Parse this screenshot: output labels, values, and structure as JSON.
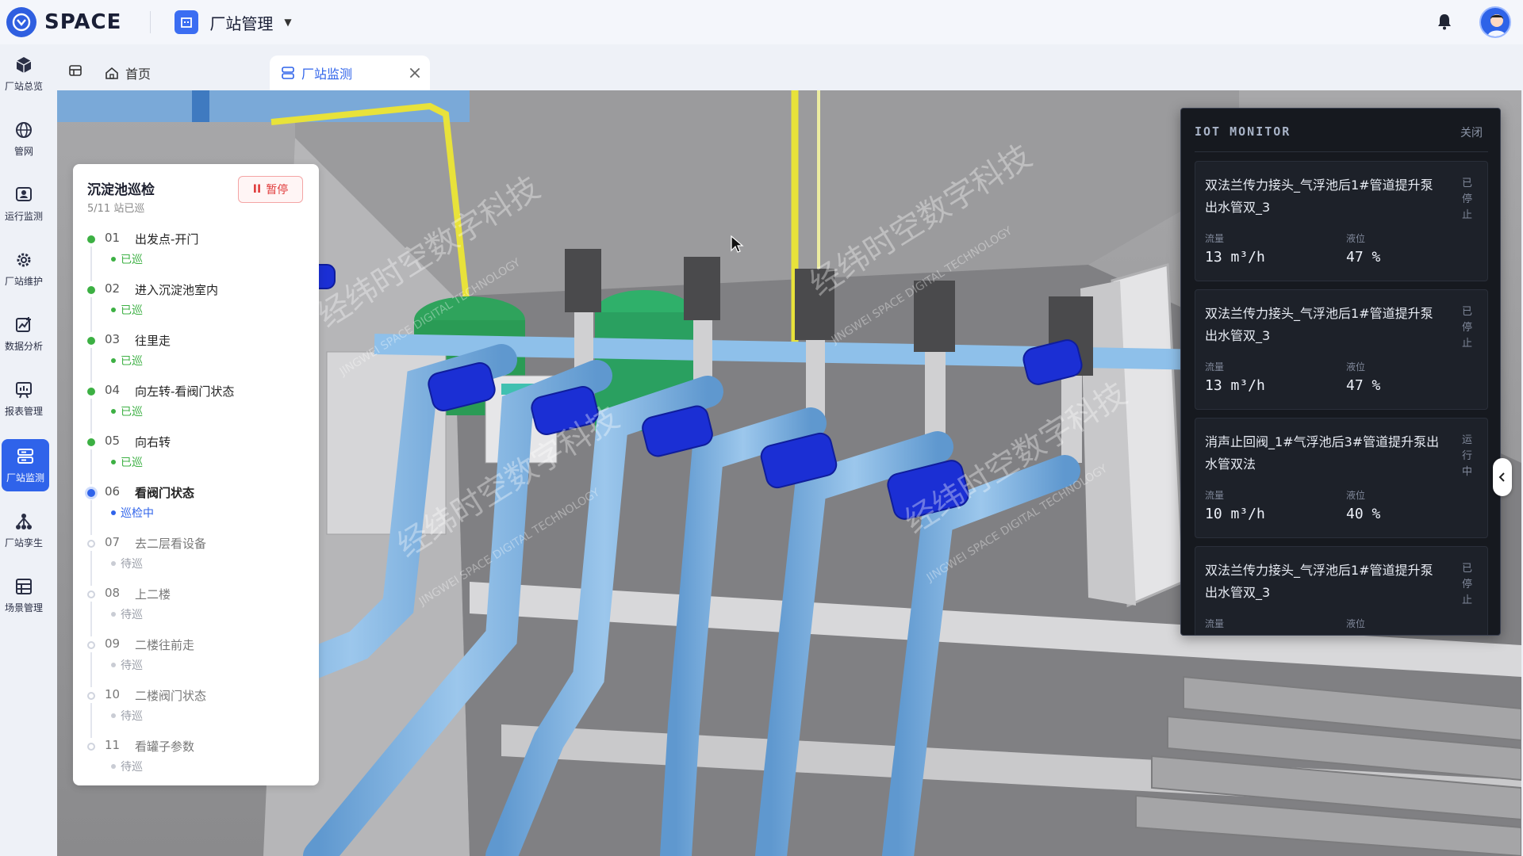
{
  "app": {
    "logo_text": "SPACE",
    "module_title": "厂站管理"
  },
  "sidebar": {
    "items": [
      {
        "label": "厂站总览",
        "icon": "cube-icon"
      },
      {
        "label": "管网",
        "icon": "globe-icon"
      },
      {
        "label": "运行监测",
        "icon": "monitor-icon"
      },
      {
        "label": "厂站维护",
        "icon": "gear-icon"
      },
      {
        "label": "数据分析",
        "icon": "chart-icon"
      },
      {
        "label": "报表管理",
        "icon": "report-icon"
      },
      {
        "label": "厂站监测",
        "icon": "server-icon",
        "active": true
      },
      {
        "label": "厂站孪生",
        "icon": "network-icon"
      },
      {
        "label": "场景管理",
        "icon": "scene-icon"
      }
    ]
  },
  "tabs": {
    "home": "首页",
    "active": "厂站监测"
  },
  "patrol": {
    "title": "沉淀池巡检",
    "progress": "5/11 站已巡",
    "pause_label": "暂停",
    "steps": [
      {
        "no": "01",
        "name": "出发点-开门",
        "status": "已巡"
      },
      {
        "no": "02",
        "name": "进入沉淀池室内",
        "status": "已巡"
      },
      {
        "no": "03",
        "name": "往里走",
        "status": "已巡"
      },
      {
        "no": "04",
        "name": "向左转-看阀门状态",
        "status": "已巡"
      },
      {
        "no": "05",
        "name": "向右转",
        "status": "已巡"
      },
      {
        "no": "06",
        "name": "看阀门状态",
        "status": "巡检中"
      },
      {
        "no": "07",
        "name": "去二层看设备",
        "status": "待巡"
      },
      {
        "no": "08",
        "name": "上二楼",
        "status": "待巡"
      },
      {
        "no": "09",
        "name": "二楼往前走",
        "status": "待巡"
      },
      {
        "no": "10",
        "name": "二楼阀门状态",
        "status": "待巡"
      },
      {
        "no": "11",
        "name": "看罐子参数",
        "status": "待巡"
      }
    ]
  },
  "iot": {
    "title": "IOT MONITOR",
    "close_label": "关闭",
    "flow_label": "流量",
    "level_label": "液位",
    "cards": [
      {
        "name": "双法兰传力接头_气浮池后1#管道提升泵出水管双_3",
        "state": "已停止",
        "flow": "13 m³/h",
        "level": "47 %"
      },
      {
        "name": "双法兰传力接头_气浮池后1#管道提升泵出水管双_3",
        "state": "已停止",
        "flow": "13 m³/h",
        "level": "47 %"
      },
      {
        "name": "消声止回阀_1#气浮池后3#管道提升泵出水管双法",
        "state": "运行中",
        "flow": "10 m³/h",
        "level": "40 %"
      },
      {
        "name": "双法兰传力接头_气浮池后1#管道提升泵出水管双_3",
        "state": "已停止",
        "flow": "",
        "level": ""
      }
    ]
  },
  "watermark": {
    "cn": "经纬时空数字科技",
    "en": "JINGWEI SPACE DIGITAL TECHNOLOGY"
  },
  "colors": {
    "accent": "#2f63ea",
    "done": "#3cb043",
    "pause": "#e03b3b",
    "pipe": "#7fb4e0",
    "coupling": "#1d2fd6"
  }
}
